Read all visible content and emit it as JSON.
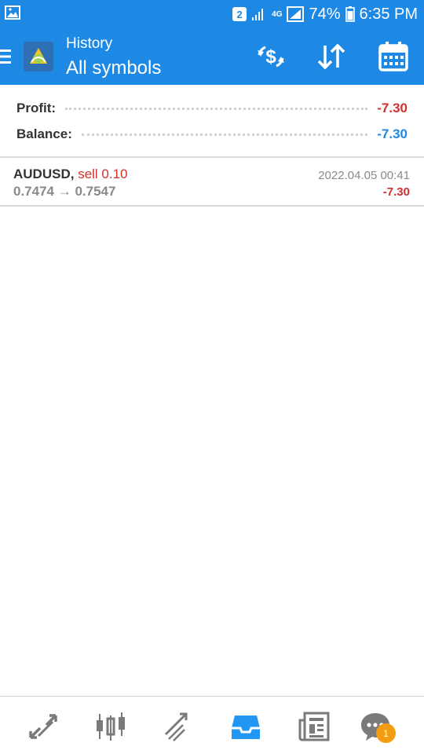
{
  "status": {
    "sim": "2",
    "network": "4G",
    "battery": "74%",
    "time": "6:35 PM"
  },
  "header": {
    "title": "History",
    "subtitle": "All symbols",
    "icons": [
      "deposit-icon",
      "sort-icon",
      "calendar-icon"
    ]
  },
  "summary": {
    "profit_label": "Profit:",
    "profit_value": "-7.30",
    "balance_label": "Balance:",
    "balance_value": "-7.30"
  },
  "trades": [
    {
      "symbol": "AUDUSD,",
      "side": "sell 0.10",
      "open_price": "0.7474",
      "close_price": "0.7547",
      "arrow": "→",
      "time": "2022.04.05 00:41",
      "profit": "-7.30"
    }
  ],
  "nav": {
    "items": [
      "quotes",
      "chart",
      "trade",
      "history",
      "news",
      "chat"
    ],
    "active": "history",
    "chat_badge": "1"
  },
  "colors": {
    "accent": "#1e88e5",
    "negative": "#d32f2f",
    "balance": "#1e88e5",
    "badge": "#f39c12"
  }
}
